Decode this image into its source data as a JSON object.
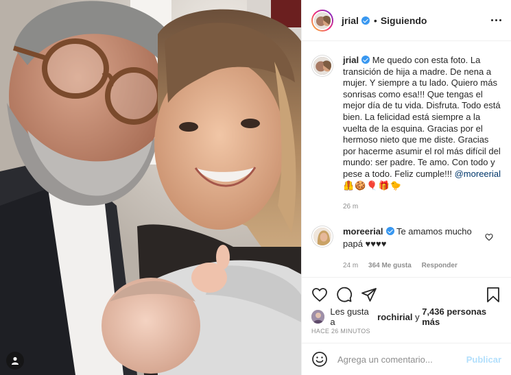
{
  "post": {
    "username": "jrial",
    "follow_status": "Siguiendo",
    "separator": "•"
  },
  "caption": {
    "username": "jrial",
    "text": "Me quedo con esta foto. La transición de hija a madre. De nena a mujer. Y siempre a tu lado. Quiero más sonrisas como esa!!! Que tengas el mejor día de tu vida. Disfruta. Todo está bien. La felicidad está siempre a la vuelta de la esquina. Gracias por el hermoso nieto que me diste. Gracias por hacerme asumir el rol más difícil del mundo: ser padre. Te amo. Con todo y pese a todo. Feliz cumple!!!",
    "mention": "@moreerial",
    "emojis": "🦺🍪🎈🎁🐤",
    "time": "26 m"
  },
  "comment": {
    "username": "moreerial",
    "text": "Te amamos mucho papá ♥♥♥♥",
    "time": "24 m",
    "likes": "364 Me gusta",
    "reply": "Responder"
  },
  "likes": {
    "prefix": "Les gusta a",
    "user": "rochirial",
    "connector": "y",
    "others": "7,436 personas más"
  },
  "timestamp": "HACE 26 MINUTOS",
  "add_comment": {
    "placeholder": "Agrega un comentario...",
    "publish": "Publicar"
  },
  "icons": {
    "like": "heart-icon",
    "comment": "comment-icon",
    "share": "share-icon",
    "save": "bookmark-icon",
    "more": "more-options-icon",
    "emoji": "emoji-icon",
    "user_tags": "user-tag-icon"
  },
  "colors": {
    "verified": "#3897f0",
    "link": "#00376b",
    "publish_disabled": "#b2dffc",
    "meta_gray": "#8e8e8e"
  }
}
